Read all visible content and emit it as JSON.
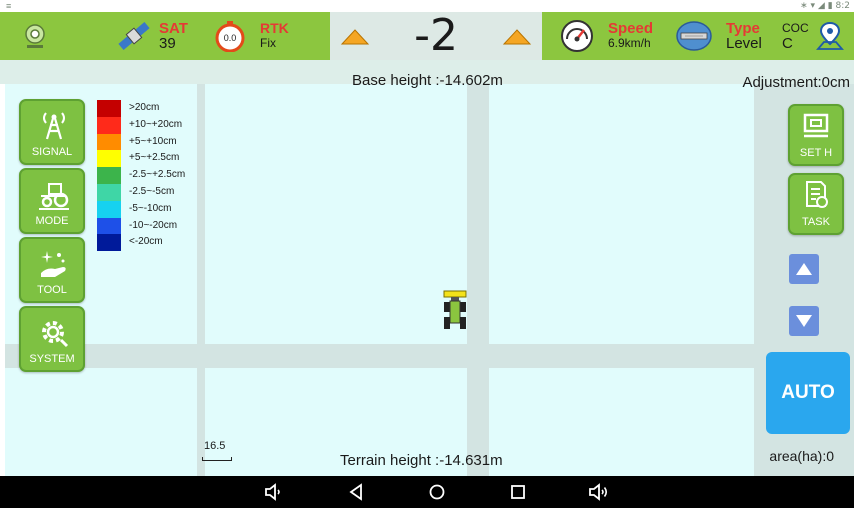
{
  "status_bar": {
    "time": "8:2"
  },
  "header": {
    "sat": {
      "label": "SAT",
      "value": "39"
    },
    "rtk": {
      "icon_value": "0.0",
      "label": "RTK",
      "value": "Fix"
    },
    "deviation": "-2",
    "speed": {
      "label": "Speed",
      "value": "6.9km/h"
    },
    "type": {
      "label": "Type",
      "value": "Level"
    },
    "coc": {
      "label": "COC",
      "value": "C"
    }
  },
  "map": {
    "base_height": "Base height :-14.602m",
    "adjustment": "Adjustment:0cm",
    "terrain_height": "Terrain height :-14.631m",
    "area": "area(ha):0",
    "scale": "16.5"
  },
  "left_menu": [
    {
      "label": "SIGNAL",
      "icon": "signal-tower-icon"
    },
    {
      "label": "MODE",
      "icon": "tractor-icon"
    },
    {
      "label": "TOOL",
      "icon": "hand-sparkle-icon"
    },
    {
      "label": "SYSTEM",
      "icon": "gear-icon"
    }
  ],
  "legend": [
    {
      "text": ">20cm",
      "color": "#c40000"
    },
    {
      "text": "+10~+20cm",
      "color": "#ff2a1a"
    },
    {
      "text": "+5~+10cm",
      "color": "#ff8c00"
    },
    {
      "text": "+5~+2.5cm",
      "color": "#ffff00"
    },
    {
      "text": "-2.5~+2.5cm",
      "color": "#3cb44b"
    },
    {
      "text": "-2.5~-5cm",
      "color": "#3fd6a6"
    },
    {
      "text": "-5~-10cm",
      "color": "#16d2f0"
    },
    {
      "text": "-10~-20cm",
      "color": "#1e50e8"
    },
    {
      "text": "<-20cm",
      "color": "#001a9a"
    }
  ],
  "right_menu": {
    "set_h": "SET H",
    "task": "TASK",
    "auto": "AUTO"
  },
  "colors": {
    "header": "#8cc63f",
    "button": "#7ec142",
    "auto": "#2aa7ee",
    "map_cell": "#e1fcfc",
    "road": "#d3e4e2"
  }
}
